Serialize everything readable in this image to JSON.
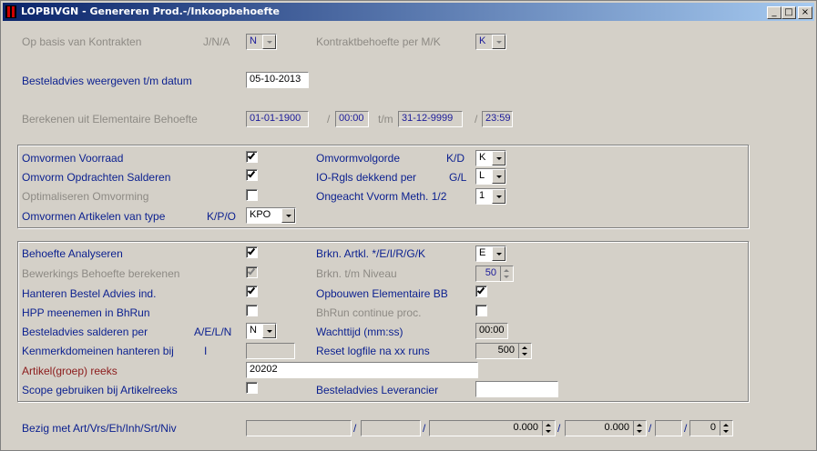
{
  "window": {
    "title": "LOPBIVGN - Genereren Prod.-/Inkoopbehoefte",
    "buttons": {
      "minimize": "_",
      "maximize": "□",
      "close": "×"
    }
  },
  "top": {
    "op_basis_label": "Op basis van Kontrakten",
    "op_basis_hint": "J/N/A",
    "op_basis_value": "N",
    "kontrakt_label": "Kontraktbehoefte per M/K",
    "kontrakt_value": "K",
    "besteladvies_label": "Besteladvies weergeven t/m datum",
    "besteladvies_date": "05-10-2013",
    "berekenen_label": "Berekenen uit Elementaire Behoefte",
    "from_date": "01-01-1900",
    "sep_slash1": "/",
    "from_time": "00:00",
    "tm_label": "t/m",
    "to_date": "31-12-9999",
    "sep_slash2": "/",
    "to_time": "23:59"
  },
  "group1": {
    "omvormen_voorraad_label": "Omvormen Voorraad",
    "omvormen_voorraad_checked": true,
    "omvorm_opdrachten_label": "Omvorm Opdrachten Salderen",
    "omvorm_opdrachten_checked": true,
    "optimaliseren_label": "Optimaliseren Omvorming",
    "optimaliseren_checked": false,
    "omvormen_artikelen_label": "Omvormen Artikelen van type",
    "omvormen_artikelen_hint": "K/P/O",
    "omvormen_artikelen_value": "KPO",
    "omvormvolgorde_label": "Omvormvolgorde",
    "omvormvolgorde_hint": "K/D",
    "omvormvolgorde_value": "K",
    "io_rgls_label": "IO-Rgls dekkend per",
    "io_rgls_hint": "G/L",
    "io_rgls_value": "L",
    "ongeacht_label": "Ongeacht Vvorm Meth. 1/2",
    "ongeacht_value": "1"
  },
  "group2": {
    "behoefte_label": "Behoefte Analyseren",
    "behoefte_checked": true,
    "bewerkings_label": "Bewerkings Behoefte berekenen",
    "bewerkings_checked": true,
    "hanteren_label": "Hanteren Bestel Advies ind.",
    "hanteren_checked": true,
    "hpp_label": "HPP meenemen in BhRun",
    "hpp_checked": false,
    "besteladvies_salderen_label": "Besteladvies salderen per",
    "besteladvies_salderen_hint": "A/E/L/N",
    "besteladvies_salderen_value": "N",
    "kenmerk_label": "Kenmerkdomeinen hanteren bij",
    "kenmerk_hint": "I",
    "kenmerk_value": "",
    "artikel_reeks_label": "Artikel(groep) reeks",
    "artikel_reeks_value": "20202",
    "scope_label": "Scope gebruiken bij Artikelreeks",
    "scope_checked": false,
    "brkn_artkl_label": "Brkn. Artkl. */E/I/R/G/K",
    "brkn_artkl_value": "E",
    "brkn_niveau_label": "Brkn. t/m Niveau",
    "brkn_niveau_value": "50",
    "opbouwen_label": "Opbouwen Elementaire BB",
    "opbouwen_checked": true,
    "bhrun_label": "BhRun continue proc.",
    "bhrun_checked": false,
    "wachttijd_label": "Wachttijd (mm:ss)",
    "wachttijd_value": "00:00",
    "reset_label": "Reset logfile na xx runs",
    "reset_value": "500",
    "leverancier_label": "Besteladvies Leverancier",
    "leverancier_value": ""
  },
  "status": {
    "label": "Bezig met Art/Vrs/Eh/Inh/Srt/Niv",
    "f1": "",
    "slash": "/",
    "f2": "",
    "f3": "0.000",
    "f4": "0.000",
    "f5": "",
    "f6": "0"
  }
}
